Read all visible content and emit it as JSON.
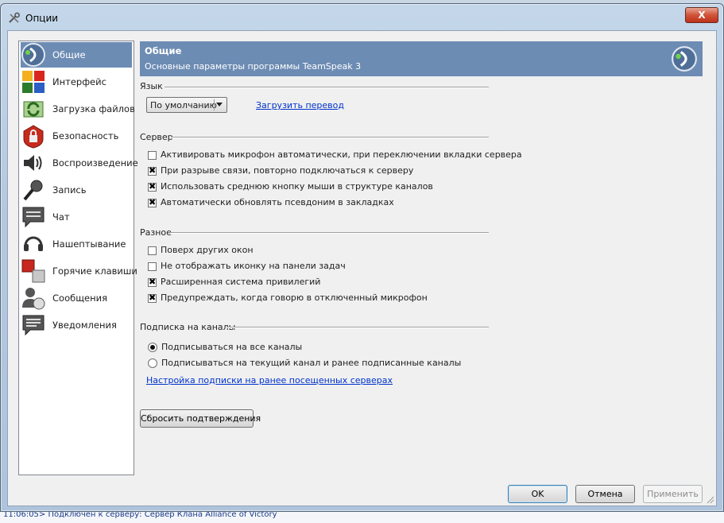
{
  "window": {
    "title": "Опции",
    "close_label": "X"
  },
  "nav": {
    "items": [
      {
        "label": "Общие",
        "icon": "teamspeak-logo-icon"
      },
      {
        "label": "Интерфейс",
        "icon": "interface-tiles-icon"
      },
      {
        "label": "Загрузка файлов",
        "icon": "file-transfer-icon"
      },
      {
        "label": "Безопасность",
        "icon": "security-lock-icon"
      },
      {
        "label": "Воспроизведение",
        "icon": "speaker-icon"
      },
      {
        "label": "Запись",
        "icon": "microphone-icon"
      },
      {
        "label": "Чат",
        "icon": "chat-bubble-icon"
      },
      {
        "label": "Нашептывание",
        "icon": "headset-icon"
      },
      {
        "label": "Горячие клавиши",
        "icon": "hotkeys-icon"
      },
      {
        "label": "Сообщения",
        "icon": "messages-user-icon"
      },
      {
        "label": "Уведомления",
        "icon": "notification-bubble-icon"
      }
    ]
  },
  "header": {
    "title": "Общие",
    "subtitle": "Основные параметры программы TeamSpeak 3"
  },
  "language": {
    "group_title": "Язык",
    "select_value": "По умолчанию",
    "download_link": "Загрузить перевод"
  },
  "server": {
    "group_title": "Сервер",
    "options": [
      {
        "label": "Активировать микрофон автоматически, при переключении вкладки сервера",
        "checked": false
      },
      {
        "label": "При разрыве связи, повторно подключаться к серверу",
        "checked": true
      },
      {
        "label": "Использовать среднюю кнопку мыши в структуре каналов",
        "checked": true
      },
      {
        "label": "Автоматически обновлять псевдоним в закладках",
        "checked": true
      }
    ]
  },
  "misc": {
    "group_title": "Разное",
    "options": [
      {
        "label": "Поверх других окон",
        "checked": false
      },
      {
        "label": "Не отображать иконку на панели задач",
        "checked": false
      },
      {
        "label": "Расширенная система привилегий",
        "checked": true
      },
      {
        "label": "Предупреждать, когда говорю в отключенный микрофон",
        "checked": true
      }
    ]
  },
  "subscription": {
    "group_title": "Подписка на каналы",
    "options": [
      {
        "label": "Подписываться на все каналы",
        "selected": true
      },
      {
        "label": "Подписываться на текущий канал и ранее подписанные каналы",
        "selected": false
      }
    ],
    "settings_link": "Настройка подписки на ранее посещенных серверах"
  },
  "reset_button": "Сбросить подтверждения",
  "footer": {
    "ok": "OK",
    "cancel": "Отмена",
    "apply": "Применить"
  },
  "background_text": "11:06:05> Подключен к серверу: Сервер Клана Alliance of Victory",
  "colors": {
    "selection": "#6d8cb4",
    "link": "#0033cc",
    "close_button": "#c8452a"
  }
}
